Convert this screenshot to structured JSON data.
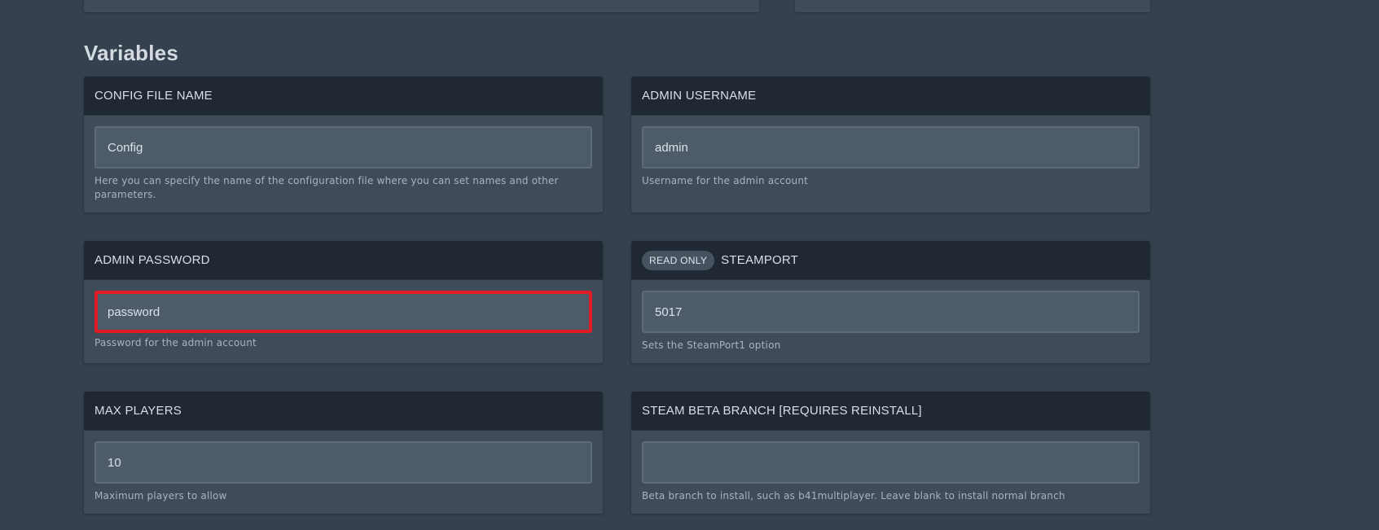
{
  "section": {
    "title": "Variables"
  },
  "fields": [
    {
      "label": "CONFIG FILE NAME",
      "value": "Config",
      "placeholder": "",
      "help": "Here you can specify the name of the configuration file where you can set names and other parameters."
    },
    {
      "label": "ADMIN USERNAME",
      "value": "admin",
      "placeholder": "",
      "help": "Username for the admin account"
    },
    {
      "label": "ADMIN PASSWORD",
      "value": "password",
      "placeholder": "",
      "help": "Password for the admin account",
      "highlighted": true
    },
    {
      "label": "STEAMPORT",
      "badge": "READ ONLY",
      "value": "5017",
      "placeholder": "",
      "help": "Sets the SteamPort1 option",
      "read_only": true
    },
    {
      "label": "MAX PLAYERS",
      "value": "10",
      "placeholder": "",
      "help": "Maximum players to allow"
    },
    {
      "label": "STEAM BETA BRANCH [REQUIRES REINSTALL]",
      "value": "",
      "placeholder": "",
      "help": "Beta branch to install, such as b41multiplayer. Leave blank to install normal branch"
    }
  ],
  "colors": {
    "page_background": "#35414e",
    "card_background": "#3f4b58",
    "card_header": "#1f2833",
    "input_background": "#4e5c6a",
    "highlight": "#e01b24"
  }
}
